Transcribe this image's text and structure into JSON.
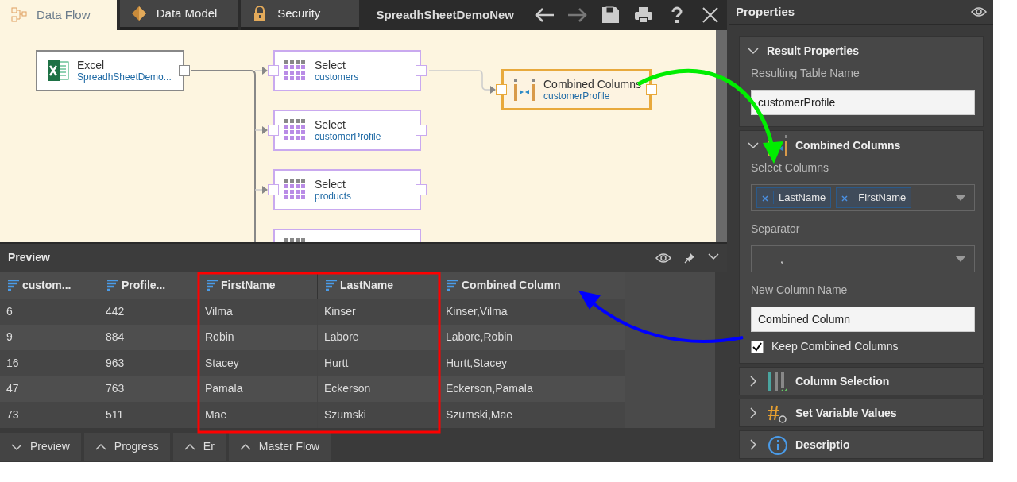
{
  "tabs": [
    {
      "label": "Data Flow",
      "kind": "flow",
      "selected": true
    },
    {
      "label": "Data Model",
      "kind": "model",
      "selected": false
    },
    {
      "label": "Security",
      "kind": "lock",
      "selected": false
    }
  ],
  "document_title": "SpreadhSheetDemoNew",
  "toolbar": [
    {
      "kind": "back",
      "disabled": false
    },
    {
      "kind": "forward",
      "disabled": true
    },
    {
      "kind": "save",
      "disabled": false
    },
    {
      "kind": "print",
      "disabled": false
    },
    {
      "kind": "help",
      "disabled": false
    },
    {
      "kind": "close",
      "disabled": false
    }
  ],
  "nodes": [
    {
      "kind": "excel",
      "title": "Excel",
      "subtitle": "SpreadhSheetDemo...",
      "selected": false
    },
    {
      "kind": "select",
      "title": "Select",
      "subtitle": "customers",
      "selected": false
    },
    {
      "kind": "select",
      "title": "Select",
      "subtitle": "customerProfile",
      "selected": false
    },
    {
      "kind": "select",
      "title": "Select",
      "subtitle": "products",
      "selected": false
    },
    {
      "kind": "select",
      "selected": false
    },
    {
      "kind": "combine",
      "title": "Combined Columns",
      "subtitle": "customerProfile",
      "selected": true
    }
  ],
  "preview": {
    "title": "Preview",
    "columns": [
      "custom...",
      "Profile...",
      "FirstName",
      "LastName",
      "Combined Column"
    ],
    "rows": [
      [
        "6",
        "442",
        "Vilma",
        "Kinser",
        "Kinser,Vilma"
      ],
      [
        "9",
        "884",
        "Robin",
        "Labore",
        "Labore,Robin"
      ],
      [
        "16",
        "963",
        "Stacey",
        "Hurtt",
        "Hurtt,Stacey"
      ],
      [
        "47",
        "763",
        "Pamala",
        "Eckerson",
        "Eckerson,Pamala"
      ],
      [
        "73",
        "511",
        "Mae",
        "Szumski",
        "Szumski,Mae"
      ]
    ]
  },
  "bottom_tabs": [
    {
      "label": "Preview",
      "expanded": true
    },
    {
      "label": "Progress",
      "expanded": false
    },
    {
      "label": "Er",
      "expanded": false
    },
    {
      "label": "Master Flow",
      "expanded": false
    }
  ],
  "properties": {
    "title": "Properties",
    "sections": [
      {
        "kind": "result",
        "title": "Result Properties",
        "expanded": true,
        "fields": [
          {
            "kind": "text",
            "label": "Resulting Table Name",
            "value": "customerProfile"
          }
        ]
      },
      {
        "kind": "combine",
        "title": "Combined Columns",
        "expanded": true,
        "fields": [
          {
            "kind": "tags",
            "label": "Select Columns",
            "tags": [
              "LastName",
              "FirstName"
            ]
          },
          {
            "kind": "dropdown",
            "label": "Separator",
            "value": ","
          },
          {
            "kind": "text",
            "label": "New Column Name",
            "value": "Combined Column"
          },
          {
            "kind": "checkbox",
            "label": "Keep Combined Columns",
            "checked": true
          }
        ]
      },
      {
        "kind": "columns",
        "title": "Column Selection",
        "expanded": false
      },
      {
        "kind": "variables",
        "title": "Set Variable Values",
        "expanded": false
      },
      {
        "kind": "info",
        "title": "Descriptio",
        "expanded": false
      }
    ]
  }
}
